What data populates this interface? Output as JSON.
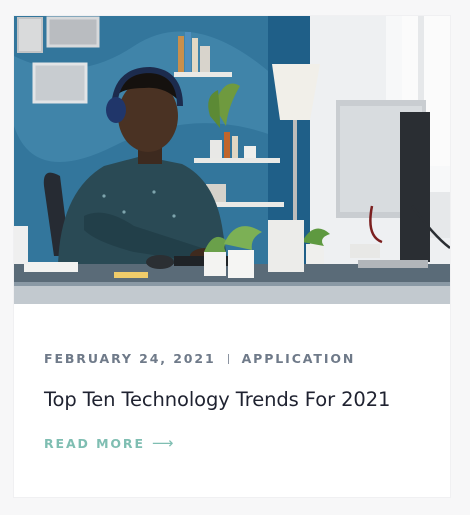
{
  "post": {
    "date": "FEBRUARY 24, 2021",
    "category": "APPLICATION",
    "title": "Top Ten Technology Trends For 2021",
    "read_more_label": "READ MORE",
    "read_more_icon": "arrow-right-icon",
    "read_more_glyph": "⟶",
    "image_subject": "man-with-headphones-at-desk-with-computer"
  },
  "colors": {
    "meta": "#6f7a89",
    "title": "#1f2230",
    "accent": "#7fbeb2",
    "card_bg": "#ffffff",
    "page_bg": "#f7f7f8"
  }
}
